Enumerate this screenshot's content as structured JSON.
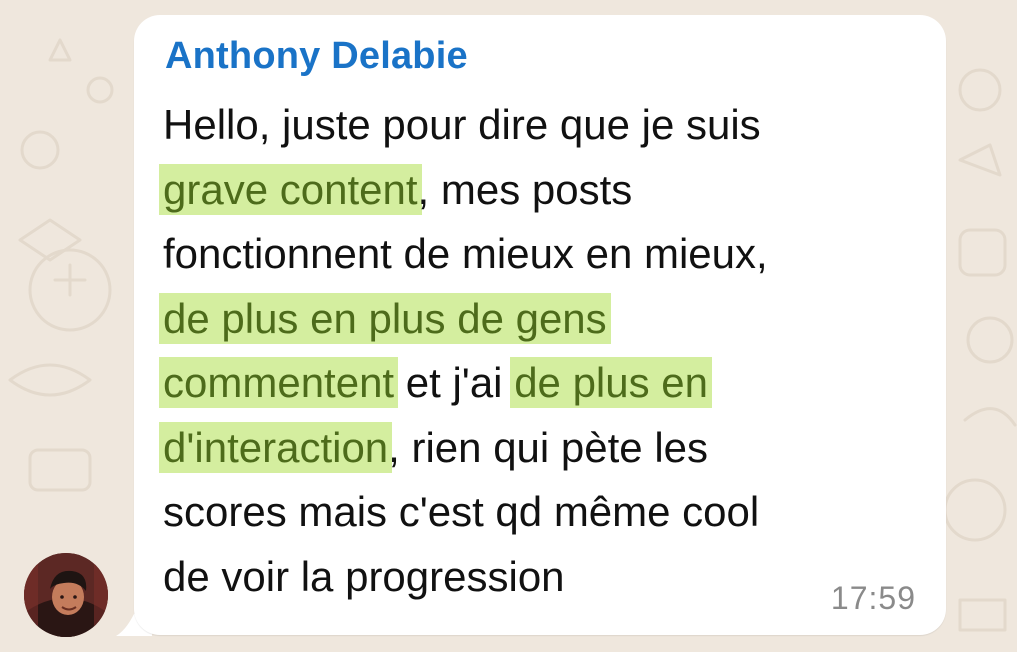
{
  "message": {
    "sender": "Anthony Delabie",
    "time": "17:59",
    "lines": [
      [
        {
          "text": "Hello, juste pour dire que je suis",
          "highlight": false
        }
      ],
      [
        {
          "text": "grave content",
          "highlight": true
        },
        {
          "text": ", mes posts",
          "highlight": false
        }
      ],
      [
        {
          "text": "fonctionnent de mieux en mieux,",
          "highlight": false
        }
      ],
      [
        {
          "text": "de plus en plus de gens",
          "highlight": true
        }
      ],
      [
        {
          "text": "commentent",
          "highlight": true
        },
        {
          "text": " et j'ai ",
          "highlight": false
        },
        {
          "text": "de plus en",
          "highlight": true
        }
      ],
      [
        {
          "text": "d'interaction",
          "highlight": true
        },
        {
          "text": ", rien qui pète les",
          "highlight": false
        }
      ],
      [
        {
          "text": "scores mais c'est qd même cool",
          "highlight": false
        }
      ],
      [
        {
          "text": "de voir la progression",
          "highlight": false
        }
      ]
    ]
  },
  "colors": {
    "wallpaper": "#efe7dd",
    "bubble": "#ffffff",
    "sender": "#1a73c7",
    "highlight_bg": "#d4ee9f",
    "highlight_text": "#4d6b1b",
    "time": "#8a8a8a"
  },
  "icons": {
    "avatar": "user-avatar-photo"
  }
}
